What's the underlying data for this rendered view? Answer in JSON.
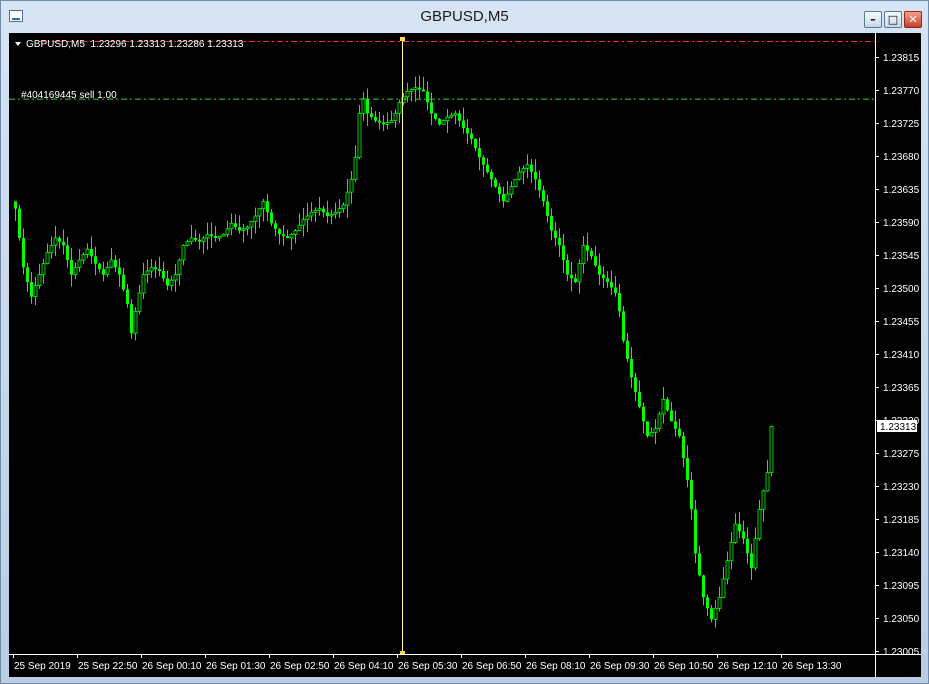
{
  "window": {
    "title": "GBPUSD,M5",
    "icons": [
      "chart-window-icon",
      "minimize-icon",
      "maximize-icon",
      "close-icon"
    ],
    "colors": {
      "background": "#000000",
      "candles": "#00ff00",
      "price_line": "#ffffff",
      "order_line": "#32cd32",
      "cursor_line": "#ffff80"
    }
  },
  "chart": {
    "symbol_info": "GBPUSD,M5  1.23296 1.23313 1.23286 1.23313",
    "order_label": "#404169445 sell 1.00",
    "current_price": "1.23313"
  },
  "chart_data": {
    "type": "candlestick",
    "symbol": "GBPUSD",
    "timeframe": "M5",
    "ylim": [
      1.23005,
      1.2384
    ],
    "y_ticks": [
      "1.23815",
      "1.23770",
      "1.23725",
      "1.23680",
      "1.23635",
      "1.23590",
      "1.23545",
      "1.23500",
      "1.23455",
      "1.23410",
      "1.23365",
      "1.23320",
      "1.23275",
      "1.23230",
      "1.23185",
      "1.23140",
      "1.23095",
      "1.23050",
      "1.23005"
    ],
    "x_ticks": [
      "25 Sep 2019",
      "25 Sep 22:50",
      "26 Sep 00:10",
      "26 Sep 01:30",
      "26 Sep 02:50",
      "26 Sep 04:10",
      "26 Sep 05:30",
      "26 Sep 06:50",
      "26 Sep 08:10",
      "26 Sep 09:30",
      "26 Sep 10:50",
      "26 Sep 12:10",
      "26 Sep 13:30"
    ],
    "order_level": 1.2376,
    "current": 1.23313,
    "close_path": [
      [
        0,
        1.2361
      ],
      [
        2,
        1.2353
      ],
      [
        4,
        1.2349
      ],
      [
        6,
        1.2352
      ],
      [
        8,
        1.2355
      ],
      [
        10,
        1.2357
      ],
      [
        12,
        1.2356
      ],
      [
        14,
        1.2352
      ],
      [
        16,
        1.2354
      ],
      [
        18,
        1.23555
      ],
      [
        20,
        1.23535
      ],
      [
        22,
        1.2352
      ],
      [
        24,
        1.2354
      ],
      [
        26,
        1.2352
      ],
      [
        28,
        1.2348
      ],
      [
        29,
        1.2344
      ],
      [
        30,
        1.2347
      ],
      [
        32,
        1.2352
      ],
      [
        34,
        1.2353
      ],
      [
        36,
        1.23525
      ],
      [
        38,
        1.23505
      ],
      [
        40,
        1.2352
      ],
      [
        42,
        1.2356
      ],
      [
        44,
        1.2357
      ],
      [
        46,
        1.23565
      ],
      [
        48,
        1.23575
      ],
      [
        50,
        1.2357
      ],
      [
        52,
        1.23575
      ],
      [
        54,
        1.2359
      ],
      [
        56,
        1.2358
      ],
      [
        58,
        1.23585
      ],
      [
        60,
        1.236
      ],
      [
        62,
        1.2362
      ],
      [
        64,
        1.2359
      ],
      [
        66,
        1.23575
      ],
      [
        68,
        1.2357
      ],
      [
        70,
        1.2358
      ],
      [
        72,
        1.23595
      ],
      [
        74,
        1.23605
      ],
      [
        76,
        1.2361
      ],
      [
        78,
        1.236
      ],
      [
        80,
        1.23605
      ],
      [
        82,
        1.23615
      ],
      [
        84,
        1.2365
      ],
      [
        85,
        1.2368
      ],
      [
        86,
        1.2374
      ],
      [
        87,
        1.2376
      ],
      [
        88,
        1.2374
      ],
      [
        90,
        1.2373
      ],
      [
        92,
        1.23725
      ],
      [
        94,
        1.2373
      ],
      [
        95,
        1.2374
      ],
      [
        96,
        1.23755
      ],
      [
        98,
        1.2377
      ],
      [
        100,
        1.23775
      ],
      [
        102,
        1.2377
      ],
      [
        104,
        1.2374
      ],
      [
        106,
        1.23725
      ],
      [
        108,
        1.23735
      ],
      [
        110,
        1.2374
      ],
      [
        112,
        1.2372
      ],
      [
        114,
        1.23705
      ],
      [
        116,
        1.2368
      ],
      [
        118,
        1.2366
      ],
      [
        120,
        1.2364
      ],
      [
        122,
        1.2362
      ],
      [
        124,
        1.2364
      ],
      [
        126,
        1.2366
      ],
      [
        128,
        1.2367
      ],
      [
        130,
        1.2365
      ],
      [
        132,
        1.2362
      ],
      [
        134,
        1.2358
      ],
      [
        136,
        1.2356
      ],
      [
        138,
        1.2352
      ],
      [
        140,
        1.2351
      ],
      [
        142,
        1.2356
      ],
      [
        144,
        1.23545
      ],
      [
        146,
        1.2352
      ],
      [
        148,
        1.2351
      ],
      [
        150,
        1.23495
      ],
      [
        151,
        1.2347
      ],
      [
        152,
        1.2343
      ],
      [
        154,
        1.2338
      ],
      [
        156,
        1.2334
      ],
      [
        158,
        1.233
      ],
      [
        160,
        1.2331
      ],
      [
        162,
        1.2335
      ],
      [
        164,
        1.2332
      ],
      [
        166,
        1.233
      ],
      [
        168,
        1.2324
      ],
      [
        169,
        1.232
      ],
      [
        170,
        1.2314
      ],
      [
        172,
        1.2308
      ],
      [
        174,
        1.2305
      ],
      [
        176,
        1.2308
      ],
      [
        178,
        1.2313
      ],
      [
        180,
        1.2318
      ],
      [
        182,
        1.2316
      ],
      [
        184,
        1.2312
      ],
      [
        186,
        1.232
      ],
      [
        188,
        1.2325
      ],
      [
        189,
        1.23313
      ]
    ]
  }
}
